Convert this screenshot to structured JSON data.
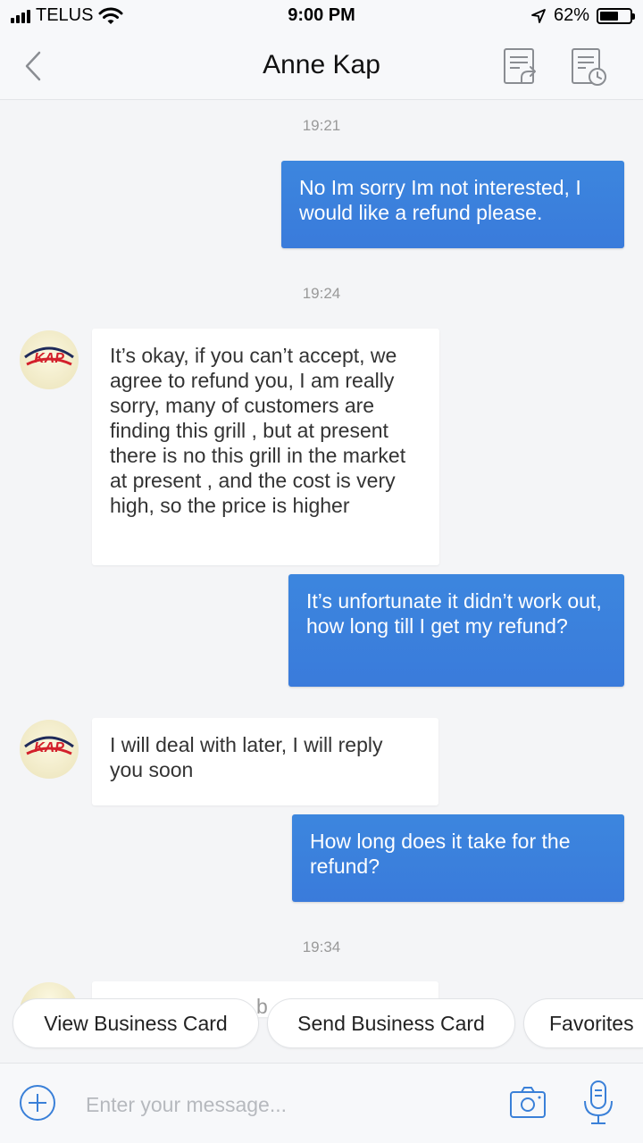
{
  "status_bar": {
    "carrier": "TELUS",
    "time": "9:00 PM",
    "battery_percent_label": "62%",
    "battery_level": 0.62,
    "icons": [
      "signal-icon",
      "wifi-icon",
      "location-arrow-icon",
      "battery-icon"
    ]
  },
  "header": {
    "title": "Anne Kap",
    "icons": [
      "back-chevron-icon",
      "upload-document-icon",
      "history-document-icon"
    ]
  },
  "chat": {
    "messages": [
      {
        "type": "timestamp",
        "text": "19:21"
      },
      {
        "type": "outgoing",
        "text": "No Im sorry Im not interested, I would like a refund please."
      },
      {
        "type": "timestamp",
        "text": "19:24"
      },
      {
        "type": "incoming",
        "text": "It’s okay, if you can’t accept, we agree to refund you,  I am really sorry, many of customers are finding this grill , but at present there is no this grill in the market at present , and the cost is very high, so the price is higher"
      },
      {
        "type": "outgoing",
        "text": "It’s unfortunate it didn’t work out, how long till I get my refund?"
      },
      {
        "type": "incoming",
        "text": "I will deal with later, I will reply you soon"
      },
      {
        "type": "outgoing",
        "text": "How long does it take for the refund?"
      },
      {
        "type": "timestamp",
        "text": "19:34"
      },
      {
        "type": "incoming",
        "text": "b"
      }
    ],
    "avatar_logo_text": "KAP"
  },
  "quick_actions": [
    "View Business Card",
    "Send Business Card",
    "Favorites"
  ],
  "input_bar": {
    "placeholder": "Enter your message...",
    "icons": [
      "plus-circle-icon",
      "camera-icon",
      "microphone-icon"
    ]
  },
  "colors": {
    "outgoing_bubble": "#3a7fdc",
    "accent_icon": "#3a80d8",
    "background": "#f4f5f7"
  }
}
